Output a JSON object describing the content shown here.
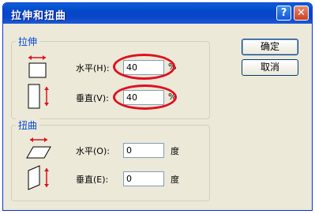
{
  "window": {
    "title": "拉伸和扭曲"
  },
  "buttons": {
    "ok": "确定",
    "cancel": "取消",
    "help": "?",
    "close": "✕"
  },
  "stretch": {
    "legend": "拉伸",
    "horizontal_label": "水平(H):",
    "horizontal_value": "40",
    "horizontal_unit": "%",
    "vertical_label": "垂直(V):",
    "vertical_value": "40",
    "vertical_unit": "%"
  },
  "skew": {
    "legend": "扭曲",
    "horizontal_label": "水平(O):",
    "horizontal_value": "0",
    "horizontal_unit": "度",
    "vertical_label": "垂直(E):",
    "vertical_value": "0",
    "vertical_unit": "度"
  },
  "annotation_color": "#e0101e"
}
